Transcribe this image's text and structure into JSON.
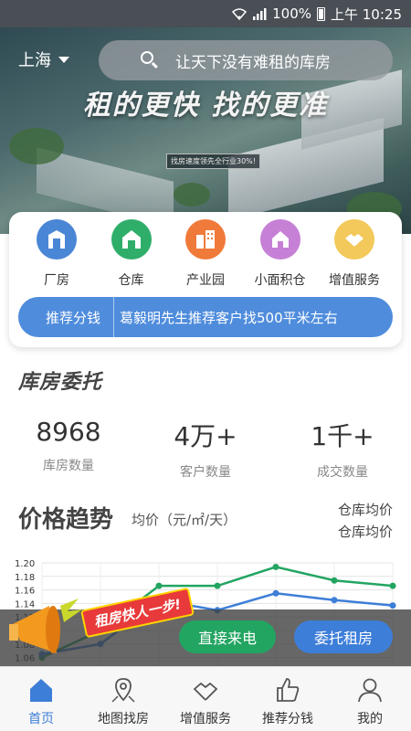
{
  "status_bar": {
    "battery": "100%",
    "time": "上午 10:25"
  },
  "header": {
    "city": "上海",
    "search_placeholder": "让天下没有难租的库房"
  },
  "hero": {
    "title": "租的更快 找的更准",
    "subtitle": "找房速度领先全行业30%!"
  },
  "categories": [
    {
      "label": "厂房",
      "icon": "factory-icon",
      "color": "#4a86d6"
    },
    {
      "label": "仓库",
      "icon": "warehouse-icon",
      "color": "#2fae6a"
    },
    {
      "label": "产业园",
      "icon": "industrial-park-icon",
      "color": "#f07a3a"
    },
    {
      "label": "小面积仓",
      "icon": "small-warehouse-icon",
      "color": "#c680d6"
    },
    {
      "label": "增值服务",
      "icon": "handshake-icon",
      "color": "#f2c95a"
    }
  ],
  "promo": {
    "tag": "推荐分钱",
    "message": "葛毅明先生推荐客户找500平米左右"
  },
  "section": {
    "logo": "库房委托",
    "stats": [
      {
        "value": "8968",
        "label": "库房数量"
      },
      {
        "value": "4万+",
        "label": "客户数量"
      },
      {
        "value": "1千+",
        "label": "成交数量"
      }
    ]
  },
  "trend": {
    "title": "价格趋势",
    "unit": "均价（元/㎡/天）",
    "legend": [
      "仓库均价",
      "仓库均价"
    ]
  },
  "chart_data": {
    "type": "line",
    "title": "价格趋势",
    "ylabel": "均价（元/㎡/天）",
    "yticks": [
      "1.20",
      "1.18",
      "1.16",
      "1.14",
      "1.12",
      "1.10",
      "1.08",
      "1.06"
    ],
    "ylim": [
      1.05,
      1.2
    ],
    "x": [
      0,
      1,
      2,
      3,
      4,
      5,
      6
    ],
    "series": [
      {
        "name": "仓库均价",
        "color": "#22a561",
        "values": [
          1.06,
          1.1,
          1.166,
          1.166,
          1.194,
          1.174,
          1.166
        ]
      },
      {
        "name": "仓库均价",
        "color": "#3d7ed8",
        "values": [
          1.065,
          1.08,
          1.145,
          1.13,
          1.155,
          1.145,
          1.137
        ]
      }
    ]
  },
  "float_banner": {
    "slogan": "租房快人一步!",
    "call_button": "直接来电",
    "entrust_button": "委托租房"
  },
  "tabbar": [
    {
      "label": "首页",
      "icon": "home-icon",
      "active": true
    },
    {
      "label": "地图找房",
      "icon": "map-pin-icon",
      "active": false
    },
    {
      "label": "增值服务",
      "icon": "handshake-icon",
      "active": false
    },
    {
      "label": "推荐分钱",
      "icon": "thumbs-up-icon",
      "active": false
    },
    {
      "label": "我的",
      "icon": "user-icon",
      "active": false
    }
  ]
}
